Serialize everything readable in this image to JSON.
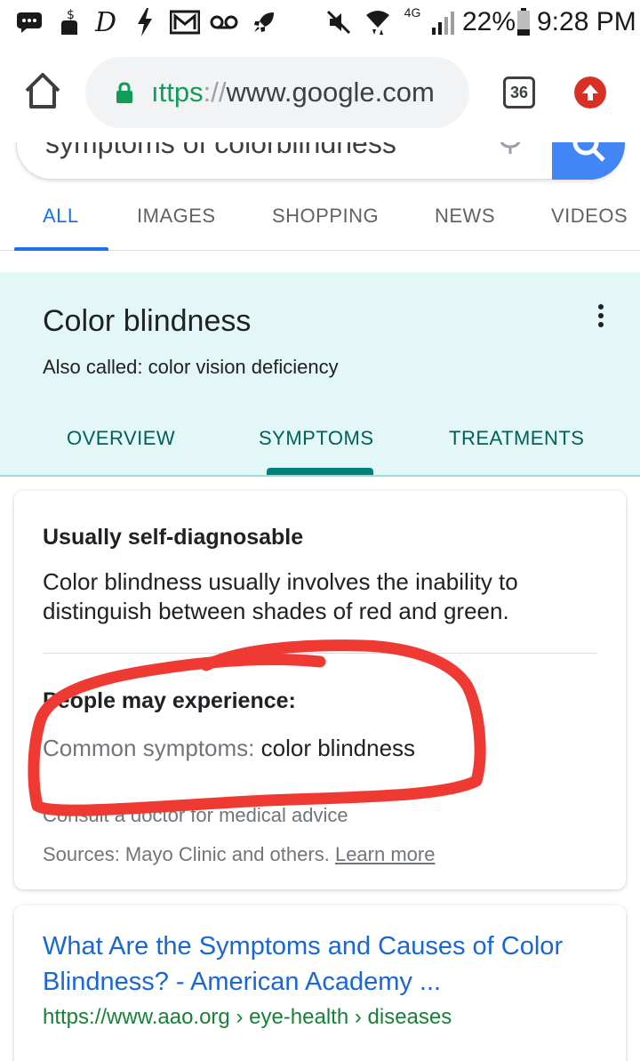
{
  "status_bar": {
    "battery": "22%",
    "time": "9:28 PM",
    "network": "4G",
    "icons": [
      "message-icon",
      "hand-dollar-icon",
      "d-app-icon",
      "flash-icon",
      "gmail-icon",
      "voicemail-icon",
      "rocket-icon",
      "mute-icon",
      "wifi-icon",
      "signal-icon",
      "battery-icon"
    ]
  },
  "browser": {
    "url_scheme": "ıttps",
    "url_sep": "://",
    "url_host": "www.google.com",
    "tab_count": "36"
  },
  "search": {
    "query": "symptoms of colorblindness"
  },
  "nav_tabs": [
    {
      "label": "ALL",
      "active": true
    },
    {
      "label": "IMAGES",
      "active": false
    },
    {
      "label": "SHOPPING",
      "active": false
    },
    {
      "label": "NEWS",
      "active": false
    },
    {
      "label": "VIDEOS",
      "active": false
    }
  ],
  "panel": {
    "title": "Color blindness",
    "subtitle": "Also called: color vision deficiency",
    "tabs": [
      "OVERVIEW",
      "SYMPTOMS",
      "TREATMENTS"
    ],
    "active_tab": "SYMPTOMS"
  },
  "card": {
    "heading": "Usually self-diagnosable",
    "body": "Color blindness usually involves the inability to distinguish between shades of red and green.",
    "heading2": "People may experience:",
    "symptoms_label": "Common symptoms:",
    "symptoms_value": "color blindness",
    "consult": "Consult a doctor for medical advice",
    "sources": "Sources: Mayo Clinic and others.",
    "learn_more": "Learn more"
  },
  "result": {
    "title": "What Are the Symptoms and Causes of Color Blindness? - American Academy ...",
    "url": "https://www.aao.org › eye-health › diseases"
  },
  "colors": {
    "link_blue": "#1967d2",
    "tab_blue": "#1a73e8",
    "panel_bg": "#e4f7f7",
    "panel_teal": "#00605a",
    "url_green": "#188038",
    "annotation_red": "#ef3a34"
  }
}
